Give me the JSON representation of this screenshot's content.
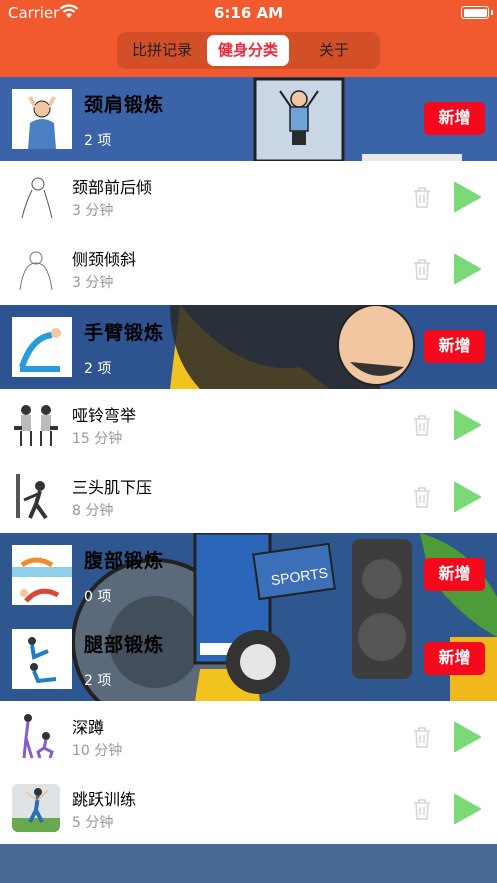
{
  "status_bar": {
    "carrier": "Carrier",
    "time": "6:16 AM"
  },
  "tabs": [
    {
      "label": "比拼记录",
      "selected": false
    },
    {
      "label": "健身分类",
      "selected": true
    },
    {
      "label": "关于",
      "selected": false
    }
  ],
  "add_label": "新增",
  "categories": [
    {
      "title": "颈肩锻炼",
      "count": "2 项"
    },
    {
      "title": "手臂锻炼",
      "count": "2 项"
    },
    {
      "title": "腹部锻炼",
      "count": "0 项"
    },
    {
      "title": "腿部锻炼",
      "count": "2 项"
    }
  ],
  "items": [
    {
      "title": "颈部前后倾",
      "duration": "3 分钟"
    },
    {
      "title": "侧颈倾斜",
      "duration": "3 分钟"
    },
    {
      "title": "哑铃弯举",
      "duration": "15 分钟"
    },
    {
      "title": "三头肌下压",
      "duration": "8 分钟"
    },
    {
      "title": "深蹲",
      "duration": "10 分钟"
    },
    {
      "title": "跳跃训练",
      "duration": "5 分钟"
    }
  ],
  "background_art_text": "SPORTS",
  "colors": {
    "header": "#f05a2e",
    "accent_red": "#f5091d",
    "selected_tab_text": "#f0283c",
    "play_green": "#7cd977",
    "background_blue": "#3a5a8c"
  },
  "icons": {
    "trash": "trash-icon",
    "play": "play-icon"
  }
}
